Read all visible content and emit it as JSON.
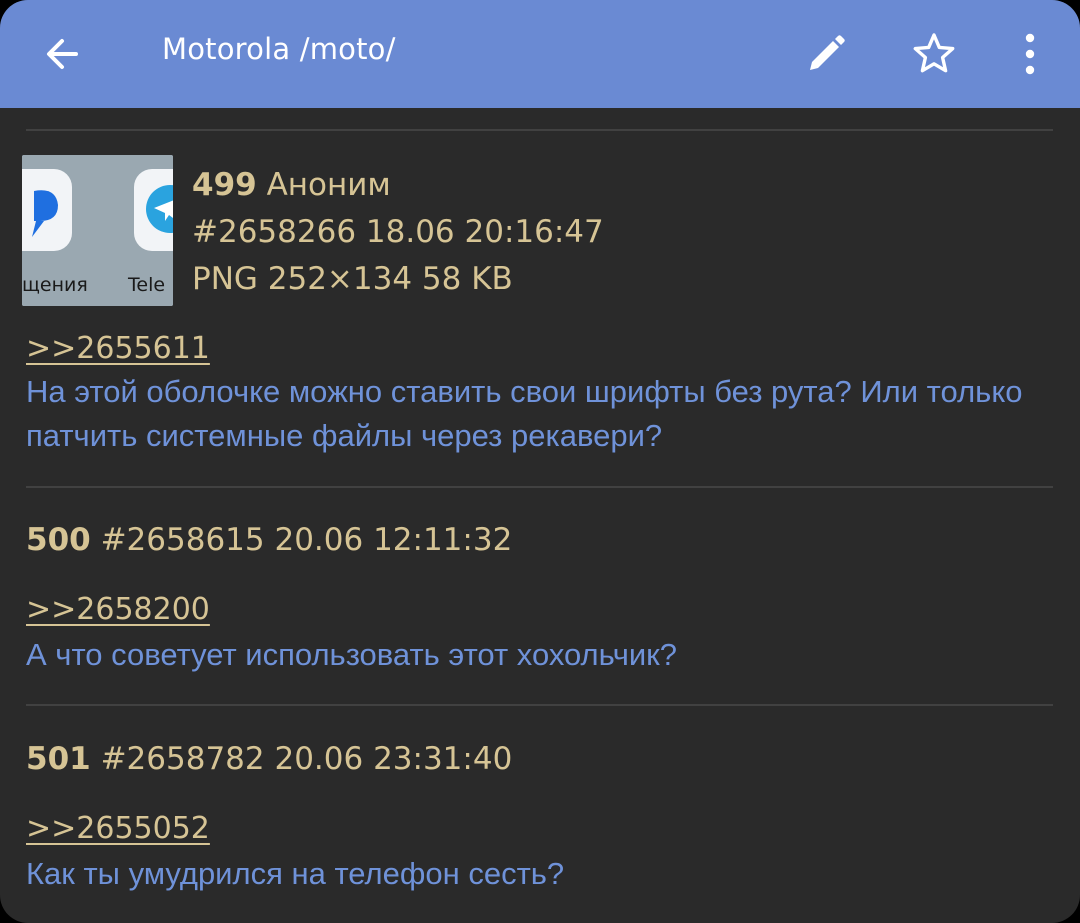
{
  "appbar": {
    "title": "Motorola /moto/",
    "icons": [
      "back-arrow-icon",
      "edit-pencil-icon",
      "star-icon",
      "more-vert-icon"
    ]
  },
  "posts": [
    {
      "number": "499",
      "author": "Аноним",
      "id_date": "#2658266 18.06 20:16:47",
      "file_info": "PNG 252×134 58 KB",
      "thumbnail_text_left": "щения",
      "thumbnail_text_right": "Tele",
      "reply_to": ">>2655611",
      "text": "На этой оболочке можно ставить свои шрифты без рута? Или только патчить системные файлы через рекавери?"
    },
    {
      "number": "500",
      "id_date": "#2658615 20.06 12:11:32",
      "reply_to": ">>2658200",
      "text": "А что советует использовать этот хохольчик?"
    },
    {
      "number": "501",
      "id_date": "#2658782 20.06 23:31:40",
      "reply_to": ">>2655052",
      "text": "Как ты умудрился на телефон сесть?"
    }
  ],
  "colors": {
    "appbar": "#6a8ad3",
    "background": "#2a2a2a",
    "meta_text": "#d6c495",
    "post_text": "#6f92d9",
    "divider": "#414141"
  }
}
